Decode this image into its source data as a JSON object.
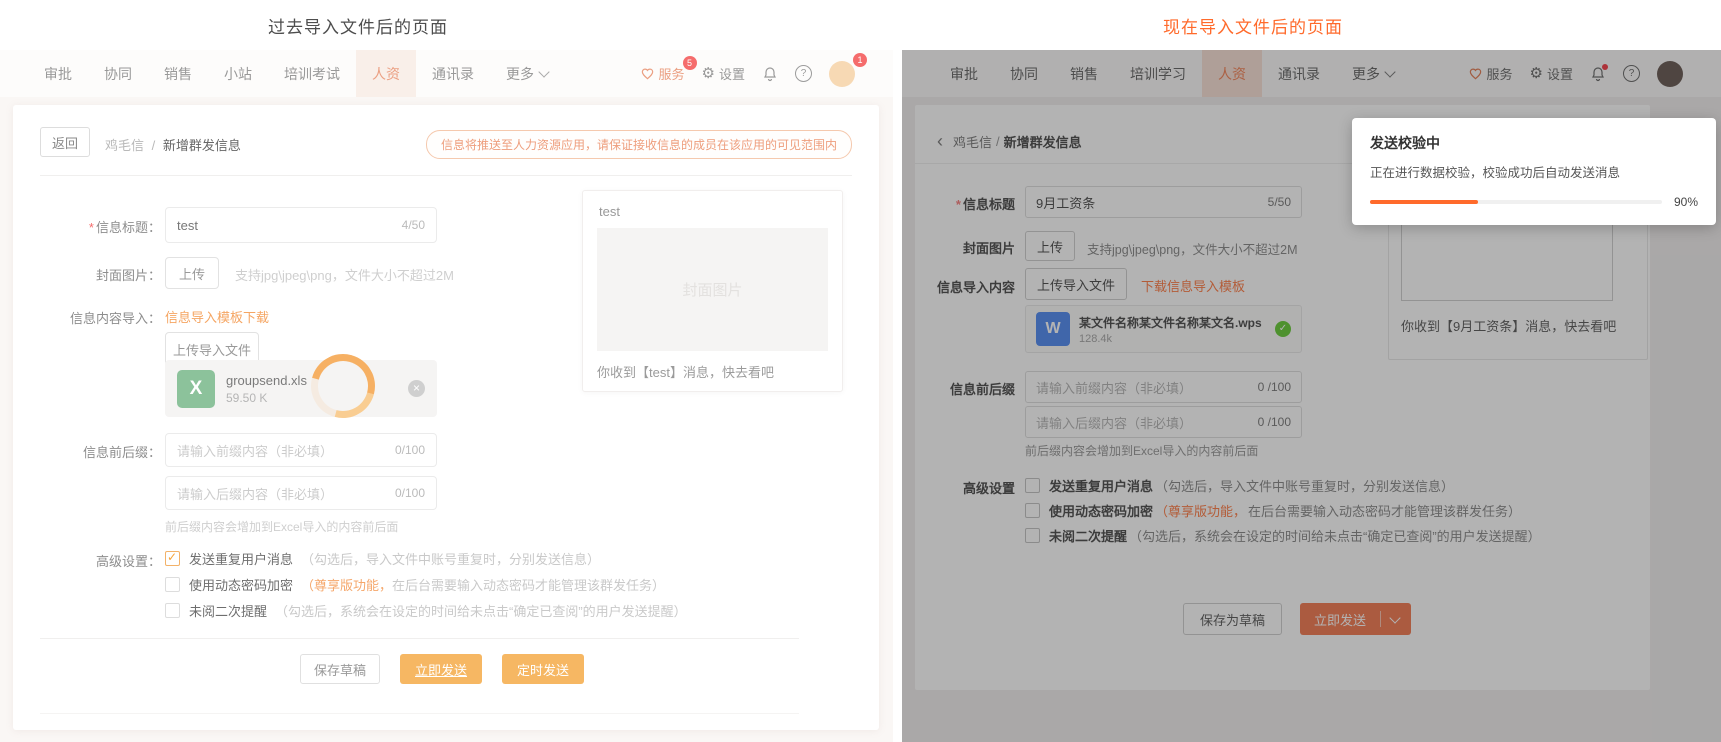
{
  "titles": {
    "left": "过去导入文件后的页面",
    "right": "现在导入文件后的页面"
  },
  "colors": {
    "accent_orange": "#ff6a2b",
    "soft_orange": "#f5a868",
    "badge_red": "#f56c6c",
    "excel_green": "#8cc29b",
    "wps_blue": "#3a7af0",
    "check_green": "#52c41a"
  },
  "left": {
    "nav": {
      "items": [
        "审批",
        "协同",
        "销售",
        "小站",
        "培训考试",
        "人资",
        "通讯录",
        "更多"
      ],
      "service": "服务",
      "service_badge": "5",
      "settings": "设置",
      "avatar_badge": "1"
    },
    "toolbar": {
      "back": "返回",
      "crumb_app": "鸡毛信",
      "crumb_sep": "/",
      "crumb_page": "新增群发信息",
      "notice": "信息将推送至人力资源应用，请保证接收信息的成员在该应用的可见范围内"
    },
    "form": {
      "required_mark": "*",
      "title_label": "信息标题：",
      "title_value": "test",
      "title_counter": "4/50",
      "cover_label": "封面图片：",
      "upload_btn": "上传",
      "cover_hint": "支持jpg\\jpeg\\png，文件大小不超过2M",
      "import_label": "信息内容导入：",
      "template_link": "信息导入模板下载",
      "import_btn": "上传导入文件",
      "file": {
        "name": "groupsend.xls",
        "size": "59.50 K",
        "icon_letter": "X"
      },
      "fix_label": "信息前后缀：",
      "prefix_placeholder": "请输入前缀内容（非必填）",
      "prefix_counter": "0/100",
      "suffix_placeholder": "请输入后缀内容（非必填）",
      "suffix_counter": "0/100",
      "fix_help": "前后缀内容会增加到Excel导入的内容前后面",
      "adv_label": "高级设置：",
      "adv_items": [
        {
          "checked": true,
          "label": "发送重复用户消息",
          "note": "（勾选后，导入文件中账号重复时，分别发送信息）"
        },
        {
          "checked": false,
          "label": "使用动态密码加密",
          "note_hl": "（尊享版功能，",
          "note": "在后台需要输入动态密码才能管理该群发任务）"
        },
        {
          "checked": false,
          "label": "未阅二次提醒",
          "note": "（勾选后，系统会在设定的时间给未点击“确定已查阅”的用户发送提醒）"
        }
      ],
      "save_btn": "保存草稿",
      "send_btn": "立即发送",
      "schedule_btn": "定时发送"
    },
    "preview": {
      "title": "test",
      "watermark": "封面图片",
      "message": "你收到【test】消息，快去看吧"
    }
  },
  "right": {
    "nav": {
      "items": [
        "审批",
        "协同",
        "销售",
        "培训学习",
        "人资",
        "通讯录",
        "更多"
      ],
      "service": "服务",
      "settings": "设置"
    },
    "toolbar": {
      "back_arrow": "‹",
      "crumb_app": "鸡毛信",
      "crumb_sep": "/",
      "crumb_page": "新增群发信息"
    },
    "form": {
      "required_mark": "*",
      "title_label": "信息标题",
      "title_value": "9月工资条",
      "title_counter": "5/50",
      "cover_label": "封面图片",
      "upload_btn": "上传",
      "cover_hint": "支持jpg\\jpeg\\png，文件大小不超过2M",
      "import_label": "信息导入内容",
      "import_btn": "上传导入文件",
      "template_link": "下载信息导入模板",
      "file": {
        "name": "某文件名称某文件名称某文名.wps",
        "size": "128.4k",
        "icon_letter": "W"
      },
      "fix_label": "信息前后缀",
      "prefix_placeholder": "请输入前缀内容（非必填）",
      "prefix_counter": "0 /100",
      "suffix_placeholder": "请输入后缀内容（非必填）",
      "suffix_counter": "0 /100",
      "fix_help": "前后缀内容会增加到Excel导入的内容前后面",
      "adv_label": "高级设置",
      "adv_items": [
        {
          "checked": false,
          "label": "发送重复用户消息",
          "note": "（勾选后，导入文件中账号重复时，分别发送信息）"
        },
        {
          "checked": false,
          "label": "使用动态密码加密",
          "note_hl": "（尊享版功能，",
          "note": "在后台需要输入动态密码才能管理该群发任务）"
        },
        {
          "checked": false,
          "label": "未阅二次提醒",
          "note": "（勾选后，系统会在设定的时间给未点击“确定已查阅”的用户发送提醒）"
        }
      ],
      "save_btn": "保存为草稿",
      "send_btn": "立即发送"
    },
    "preview": {
      "message": "你收到【9月工资条】消息，快去看吧"
    },
    "toast": {
      "title": "发送校验中",
      "desc": "正在进行数据校验，校验成功后自动发送消息",
      "percent_label": "90%",
      "fill_pct": 37
    }
  }
}
